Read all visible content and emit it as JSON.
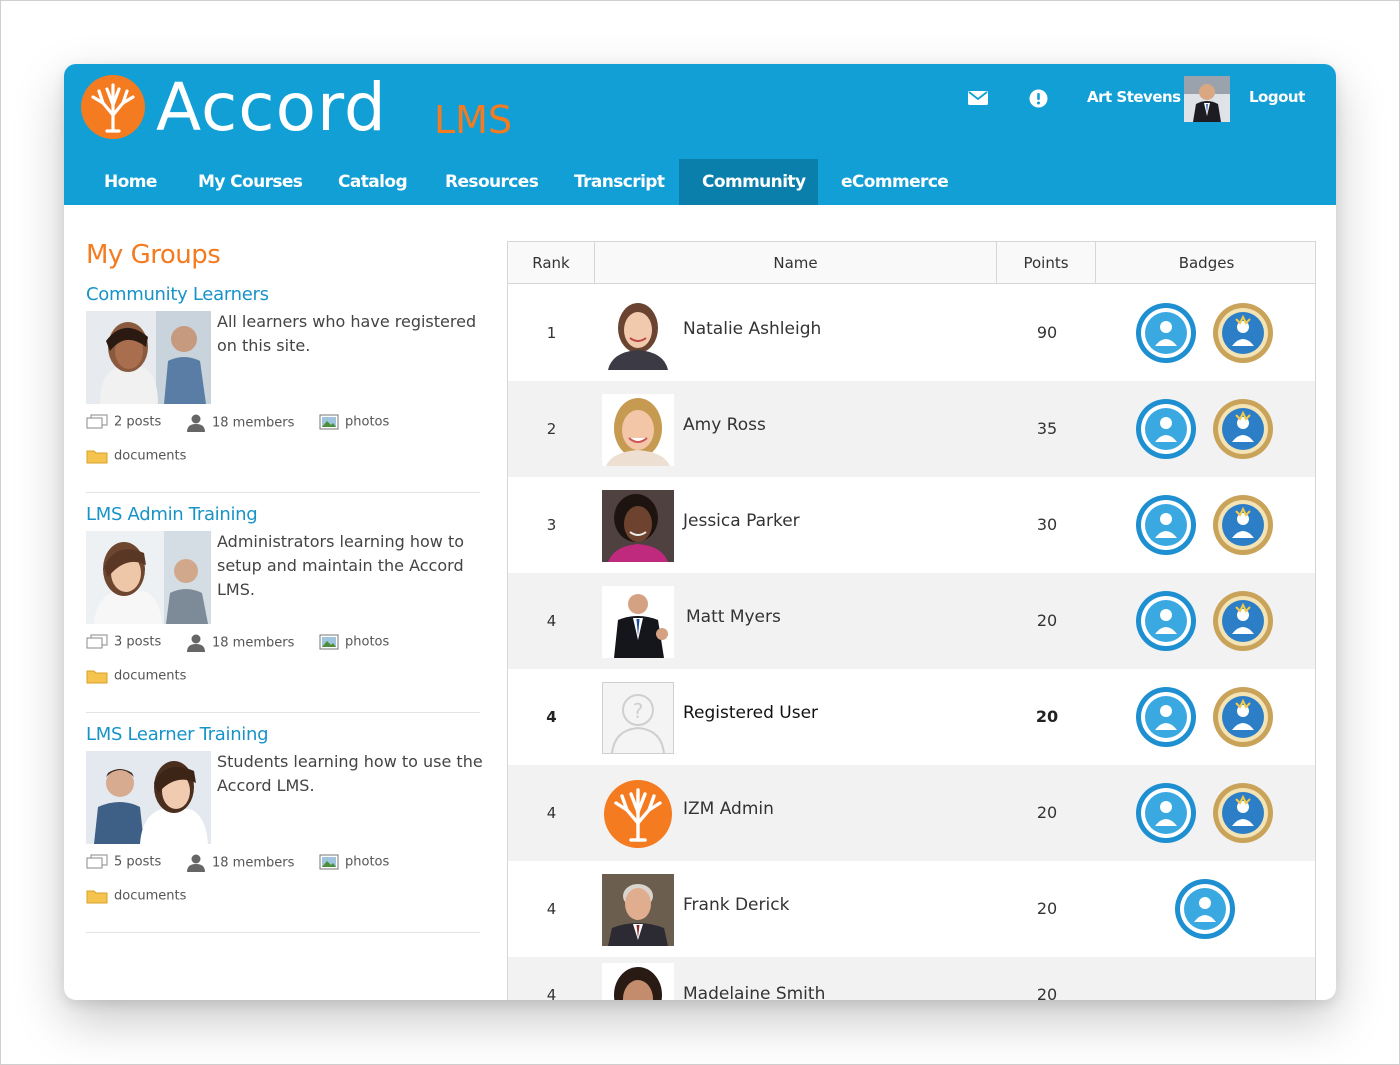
{
  "app": {
    "logo_text": "Accord",
    "logo_sub": "LMS",
    "user_name": "Art Stevens",
    "logout_label": "Logout"
  },
  "nav": [
    {
      "label": "Home"
    },
    {
      "label": "My Courses"
    },
    {
      "label": "Catalog"
    },
    {
      "label": "Resources"
    },
    {
      "label": "Transcript"
    },
    {
      "label": "Community",
      "active": true
    },
    {
      "label": "eCommerce"
    }
  ],
  "groups": {
    "title": "My Groups",
    "items": [
      {
        "title": "Community Learners",
        "description": "All learners who have registered on this site.",
        "posts": "2 posts",
        "members": "18 members",
        "photos": "photos",
        "documents": "documents"
      },
      {
        "title": "LMS Admin Training",
        "description": "Administrators learning how to setup and maintain the Accord LMS.",
        "posts": "3 posts",
        "members": "18 members",
        "photos": "photos",
        "documents": "documents"
      },
      {
        "title": "LMS Learner Training",
        "description": "Students learning how to use the Accord LMS.",
        "posts": "5 posts",
        "members": "18 members",
        "photos": "photos",
        "documents": "documents"
      }
    ]
  },
  "leaderboard": {
    "headers": {
      "rank": "Rank",
      "name": "Name",
      "points": "Points",
      "badges": "Badges"
    },
    "rows": [
      {
        "rank": "1",
        "name": "Natalie Ashleigh",
        "points": "90",
        "badges": 2
      },
      {
        "rank": "2",
        "name": "Amy Ross",
        "points": "35",
        "badges": 2
      },
      {
        "rank": "3",
        "name": "Jessica Parker",
        "points": "30",
        "badges": 2
      },
      {
        "rank": "4",
        "name": "Matt Myers",
        "points": "20",
        "badges": 2
      },
      {
        "rank": "4",
        "name": "Registered User",
        "points": "20",
        "badges": 2,
        "bold": true
      },
      {
        "rank": "4",
        "name": "IZM Admin",
        "points": "20",
        "badges": 2
      },
      {
        "rank": "4",
        "name": "Frank Derick",
        "points": "20",
        "badges": 1
      },
      {
        "rank": "4",
        "name": "Madelaine Smith",
        "points": "20",
        "badges": 0
      }
    ]
  },
  "colors": {
    "header_bg": "#119fd6",
    "nav_active": "#0b7fab",
    "brand_orange": "#f47b20",
    "link_blue": "#1793c8"
  }
}
